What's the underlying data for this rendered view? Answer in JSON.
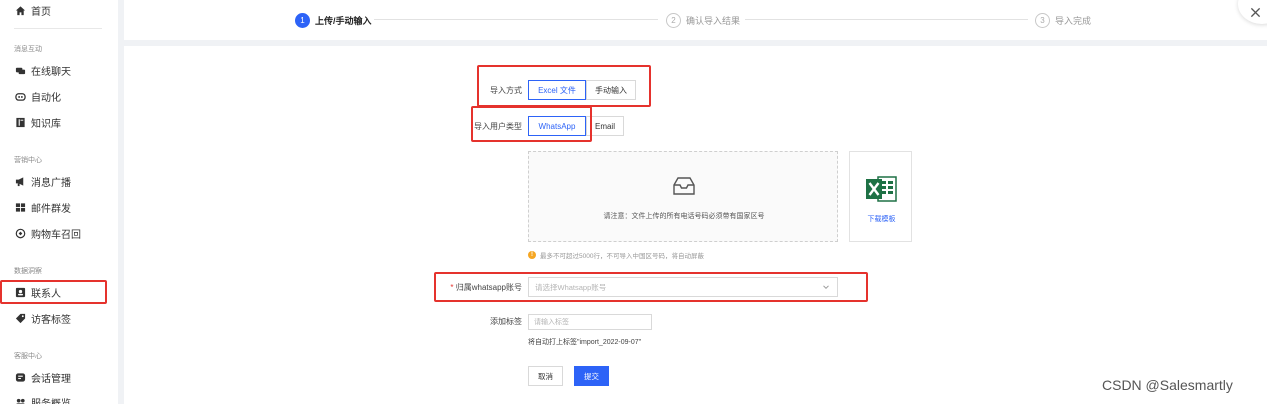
{
  "sidebar": {
    "home": "首页",
    "groups": {
      "messaging": "消息互动",
      "marketing": "营销中心",
      "data": "数据洞察",
      "support": "客服中心"
    },
    "items": {
      "live_chat": "在线聊天",
      "automation": "自动化",
      "knowledge": "知识库",
      "broadcast": "消息广播",
      "email_send": "邮件群发",
      "cart_recovery": "购物车召回",
      "contacts": "联系人",
      "visitor_tags": "访客标签",
      "sessions": "会话管理",
      "service_overview": "服务概览"
    }
  },
  "steps": [
    {
      "num": "1",
      "label": "上传/手动输入"
    },
    {
      "num": "2",
      "label": "确认导入结果"
    },
    {
      "num": "3",
      "label": "导入完成"
    }
  ],
  "form": {
    "import_method_label": "导入方式",
    "import_methods": [
      "Excel 文件",
      "手动输入"
    ],
    "user_type_label": "导入用户类型",
    "user_types": [
      "WhatsApp",
      "Email"
    ],
    "upload_notice": "请注意：文件上传的所有电话号码必须带有国家区号",
    "download_template": "下载模板",
    "tip": "最多不可超过5000行，不可导入中国区号码，将自动屏蔽",
    "required_mark": "*",
    "account_label": "归属whatsapp账号",
    "account_placeholder": "请选择Whatsapp账号",
    "tag_label": "添加标签",
    "tag_placeholder": "请输入标签",
    "tag_hint": "将自动打上标签\"import_2022-09-07\"",
    "cancel": "取消",
    "submit": "提交"
  },
  "watermark": "CSDN @Salesmartly",
  "colors": {
    "primary": "#2d63f7",
    "highlight": "#e5322d",
    "warning": "#f5a623",
    "excel_green": "#1e7145"
  }
}
